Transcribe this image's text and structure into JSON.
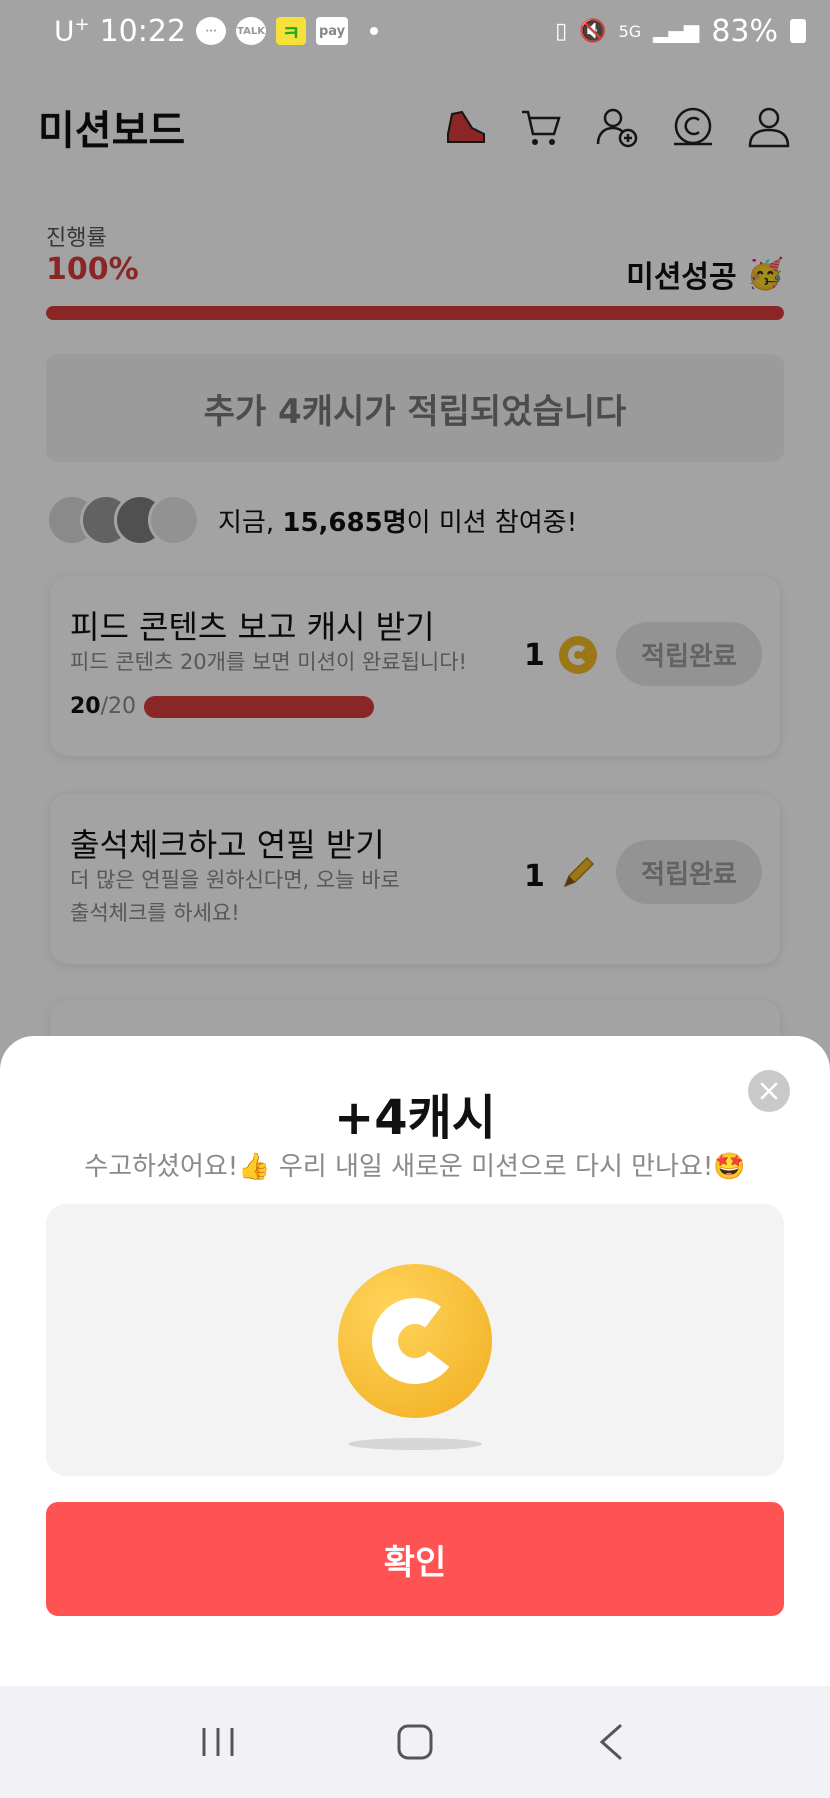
{
  "status_bar": {
    "carrier": "U",
    "carrier_sup": "+",
    "time": "10:22",
    "network": "5G",
    "battery": "83%"
  },
  "header": {
    "title": "미션보드",
    "icons": [
      "sneaker-icon",
      "cart-icon",
      "add-friend-icon",
      "cash-icon",
      "profile-icon"
    ]
  },
  "progress": {
    "label": "진행률",
    "value": "100%",
    "status": "미션성공",
    "status_emoji": "🥳",
    "fill_percent": 100
  },
  "bonus_banner": "추가 4캐시가 적립되었습니다",
  "participants": {
    "prefix": "지금, ",
    "count": "15,685명",
    "suffix": "이 미션 참여중!"
  },
  "missions": [
    {
      "title": "피드 콘텐츠 보고 캐시 받기",
      "desc": "피드 콘텐츠 20개를 보면 미션이 완료됩니다!",
      "done": "20",
      "total": "/20",
      "reward": "1",
      "button": "적립완료"
    },
    {
      "title": "출석체크하고 연필 받기",
      "desc": "더 많은 연필을 원하신다면, 오늘 바로 출석체크를 하세요!",
      "reward": "1",
      "button": "적립완료"
    }
  ],
  "modal": {
    "title": "+4캐시",
    "subtitle": "수고하셨어요!👍 우리 내일 새로운 미션으로 다시 만나요!🤩",
    "confirm": "확인"
  },
  "colors": {
    "accent": "#d83c3c",
    "confirm": "#ff5353",
    "coin": "#f2bb25"
  }
}
